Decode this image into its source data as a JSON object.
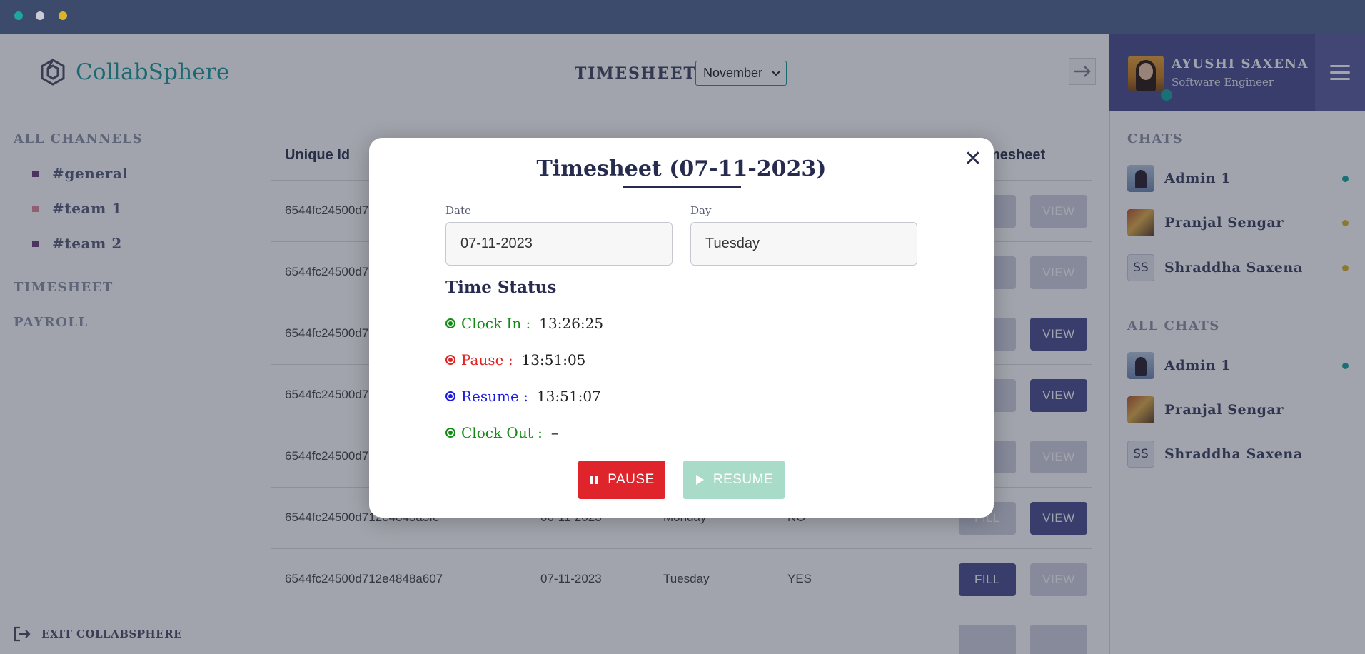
{
  "app": {
    "brand": "CollabSphere",
    "accent_color": "#1a9a9c",
    "primary_color": "#4b4f8f"
  },
  "window": {
    "dots": [
      "#1fa6a3",
      "#c9cbd8",
      "#d8b52a"
    ]
  },
  "sidebar": {
    "channels_heading": "ALL CHANNELS",
    "channels": [
      {
        "label": "#general",
        "color": "#6b3f7a"
      },
      {
        "label": "#team 1",
        "color": "#e08a9a"
      },
      {
        "label": "#team 2",
        "color": "#6b3f7a"
      }
    ],
    "timesheet_label": "TIMESHEET",
    "payroll_label": "PAYROLL",
    "exit_label": "EXIT COLLABSPHERE"
  },
  "header": {
    "title": "TIMESHEET",
    "month_selected": "November"
  },
  "user": {
    "name": "AYUSHI SAXENA",
    "role": "Software Engineer"
  },
  "chats": {
    "heading": "CHATS",
    "items": [
      {
        "name": "Admin 1",
        "status_color": "#19a6a2"
      },
      {
        "name": "Pranjal Sengar",
        "status_color": "#d8b52a"
      },
      {
        "name": "Shraddha Saxena",
        "initials": "SS",
        "status_color": "#d8b52a"
      }
    ]
  },
  "all_chats": {
    "heading": "ALL CHATS",
    "items": [
      {
        "name": "Admin 1",
        "status_color": "#19a6a2"
      },
      {
        "name": "Pranjal Sengar"
      },
      {
        "name": "Shraddha Saxena",
        "initials": "SS"
      }
    ]
  },
  "table": {
    "headers": {
      "unique_id": "Unique Id",
      "timesheet": "mesheet"
    },
    "rows": [
      {
        "id": "6544fc24500d7",
        "fill_enabled": false,
        "view_enabled": false,
        "fill": "",
        "view": "VIEW"
      },
      {
        "id": "6544fc24500d7",
        "fill_enabled": false,
        "view_enabled": false,
        "fill": "",
        "view": "VIEW"
      },
      {
        "id": "6544fc24500d7",
        "fill_enabled": false,
        "view_enabled": true,
        "fill": "",
        "view": "VIEW"
      },
      {
        "id": "6544fc24500d7",
        "fill_enabled": false,
        "view_enabled": true,
        "fill": "",
        "view": "VIEW"
      },
      {
        "id": "6544fc24500d7",
        "fill_enabled": false,
        "view_enabled": false,
        "fill": "",
        "view": "VIEW"
      },
      {
        "id": "6544fc24500d712e4848a5fe",
        "date": "06-11-2023",
        "day": "Monday",
        "filled": "NO",
        "fill": "FILL",
        "view": "VIEW",
        "fill_enabled": false,
        "view_enabled": true
      },
      {
        "id": "6544fc24500d712e4848a607",
        "date": "07-11-2023",
        "day": "Tuesday",
        "filled": "YES",
        "fill": "FILL",
        "view": "VIEW",
        "fill_enabled": true,
        "view_enabled": false
      }
    ]
  },
  "modal": {
    "title": "Timesheet (07-11-2023)",
    "date_label": "Date",
    "date_value": "07-11-2023",
    "day_label": "Day",
    "day_value": "Tuesday",
    "status_heading": "Time Status",
    "statuses": [
      {
        "label": "Clock In :",
        "value": "13:26:25",
        "color": "#138a13"
      },
      {
        "label": "Pause :",
        "value": "13:51:05",
        "color": "#e02424"
      },
      {
        "label": "Resume :",
        "value": "13:51:07",
        "color": "#1c1ce0"
      },
      {
        "label": "Clock Out :",
        "value": "–",
        "color": "#138a13"
      }
    ],
    "pause_button": "PAUSE",
    "resume_button": "RESUME",
    "pause_color": "#e0242c",
    "resume_color": "#a9dcc8"
  }
}
